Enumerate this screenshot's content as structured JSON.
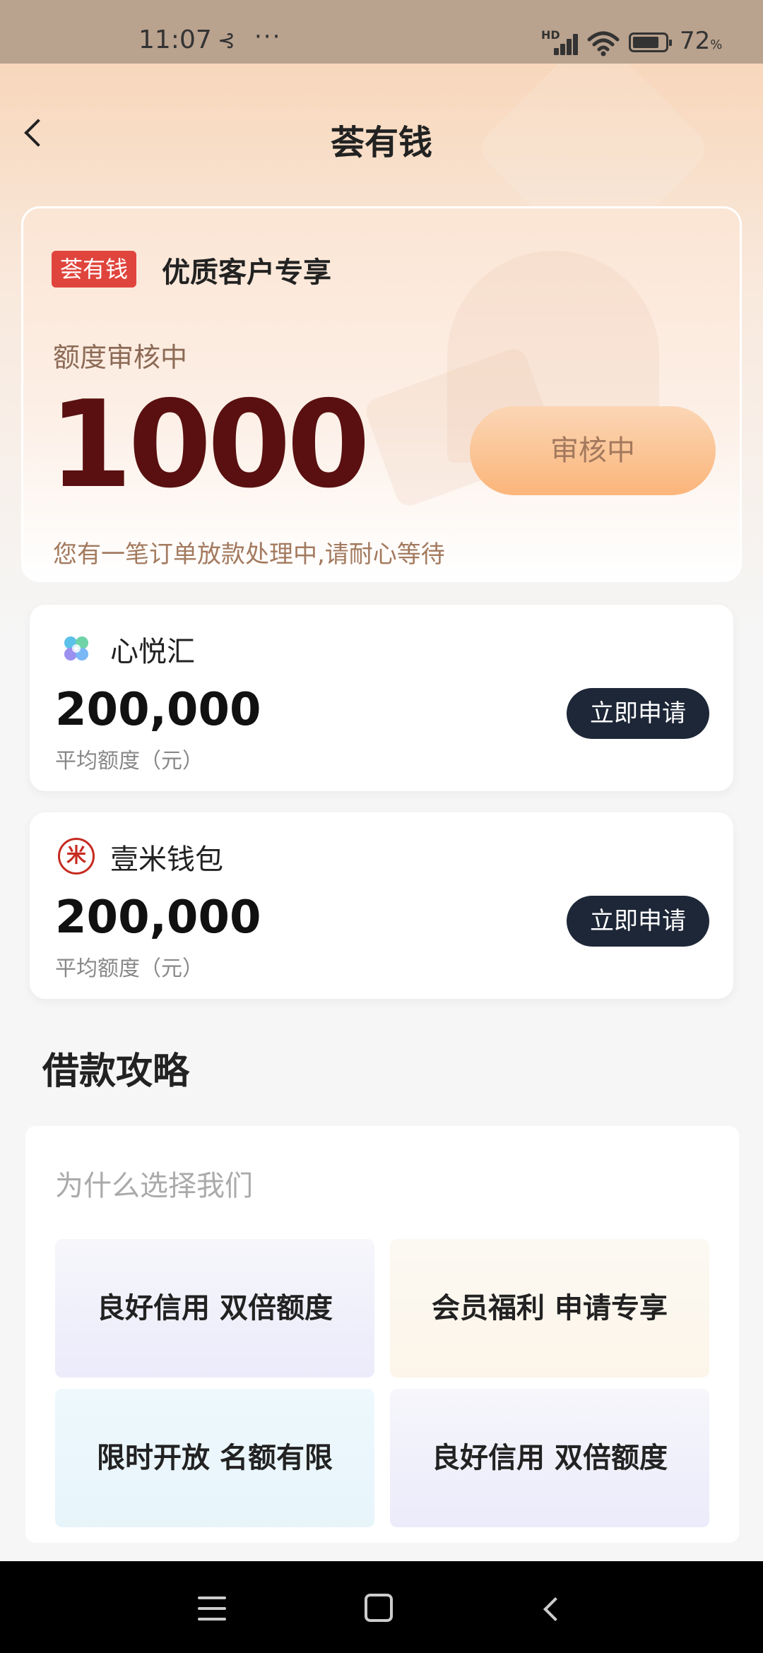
{
  "status_bar": {
    "time": "11:07",
    "share_icon": "share-nodes-icon",
    "more": "···",
    "hd": "HD",
    "battery_percent": "72",
    "battery_unit": "%"
  },
  "header": {
    "title": "荟有钱",
    "back_icon": "chevron-left-icon"
  },
  "hero": {
    "badge": "荟有钱",
    "subtitle": "优质客户专享",
    "status": "额度审核中",
    "amount": "1000",
    "button_label": "审核中",
    "note": "您有一笔订单放款处理中,请耐心等待"
  },
  "products": [
    {
      "name": "心悦汇",
      "amount": "200,000",
      "unit": "平均额度（元）",
      "apply_label": "立即申请",
      "logo_icon": "xinyuehui-logo-icon"
    },
    {
      "name": "壹米钱包",
      "amount": "200,000",
      "unit": "平均额度（元）",
      "apply_label": "立即申请",
      "logo_icon": "yimi-wallet-logo-icon",
      "logo_glyph": "米"
    }
  ],
  "guide": {
    "section_title": "借款攻略",
    "question": "为什么选择我们",
    "tiles": [
      "良好信用 双倍额度",
      "会员福利 申请专享",
      "限时开放 名额有限",
      "良好信用 双倍额度"
    ]
  },
  "colors": {
    "badge_red": "#e0453d",
    "amount_dark_red": "#5a1010",
    "apply_button": "#1d2737",
    "review_button": "#fbb57a"
  }
}
